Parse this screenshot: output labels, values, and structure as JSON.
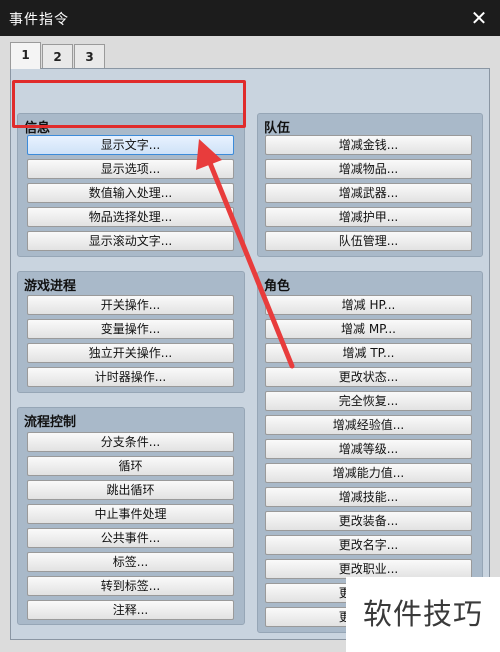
{
  "window": {
    "title": "事件指令",
    "close_symbol": "✕"
  },
  "tabs": [
    {
      "label": "1",
      "active": true
    },
    {
      "label": "2"
    },
    {
      "label": "3"
    }
  ],
  "groups": {
    "info": {
      "title": "信息",
      "buttons": [
        "显示文字...",
        "显示选项...",
        "数值输入处理...",
        "物品选择处理...",
        "显示滚动文字..."
      ]
    },
    "progress": {
      "title": "游戏进程",
      "buttons": [
        "开关操作...",
        "变量操作...",
        "独立开关操作...",
        "计时器操作..."
      ]
    },
    "flow": {
      "title": "流程控制",
      "buttons": [
        "分支条件...",
        "循环",
        "跳出循环",
        "中止事件处理",
        "公共事件...",
        "标签...",
        "转到标签...",
        "注释..."
      ]
    },
    "party": {
      "title": "队伍",
      "buttons": [
        "增减金钱...",
        "增减物品...",
        "增减武器...",
        "增减护甲...",
        "队伍管理..."
      ]
    },
    "actor": {
      "title": "角色",
      "buttons": [
        "增减 HP...",
        "增减 MP...",
        "增减 TP...",
        "更改状态...",
        "完全恢复...",
        "增减经验值...",
        "增减等级...",
        "增减能力值...",
        "增减技能...",
        "更改装备...",
        "更改名字...",
        "更改职业...",
        "更改昵称...",
        "更改档案..."
      ]
    }
  },
  "watermark": "软件技巧",
  "colors": {
    "highlight": "#e02b2b",
    "arrow": "#e83c3c",
    "panel": "#a9b9c9"
  }
}
